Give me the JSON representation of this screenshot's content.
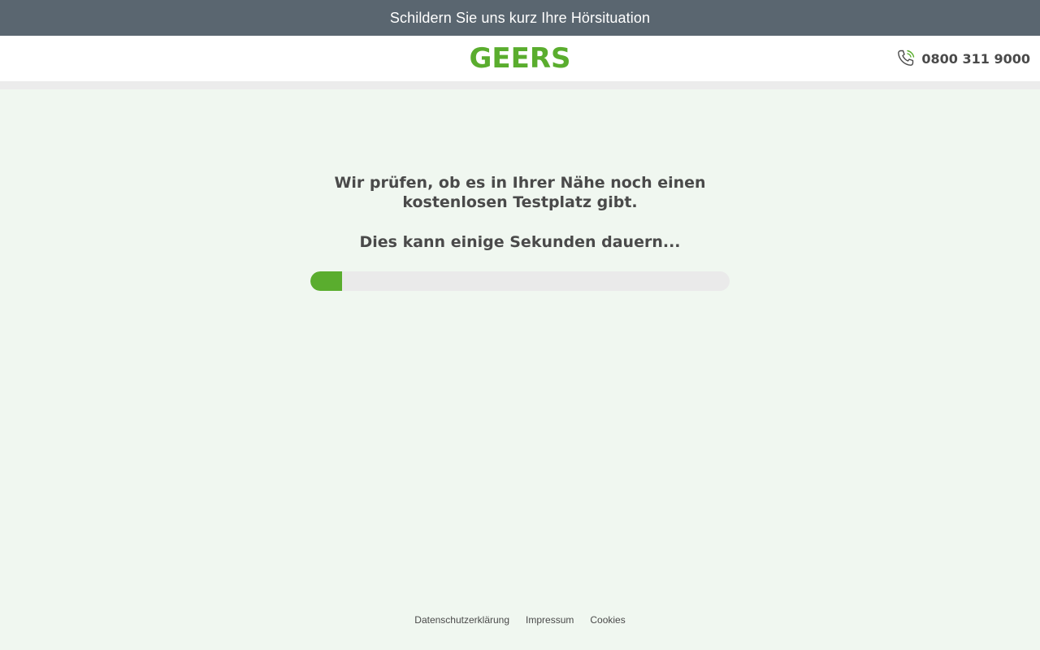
{
  "topbar": {
    "title": "Schildern Sie uns kurz Ihre Hörsituation"
  },
  "header": {
    "logo_text": "GEERS",
    "phone_number": "0800 311 9000",
    "phone_icon": "phone-icon"
  },
  "main": {
    "message": "Wir prüfen, ob es in Ihrer Nähe noch einen kostenlosen Testplatz gibt.",
    "wait_message": "Dies kann einige Sekunden dauern...",
    "progress_percent": 7.5
  },
  "footer": {
    "links": [
      "Datenschutzerklärung",
      "Impressum",
      "Cookies"
    ]
  },
  "colors": {
    "brand_green": "#5aad2e",
    "topbar_bg": "#5a6670",
    "page_bg": "#f0f7f0",
    "text_dark": "#4a4a4a"
  }
}
